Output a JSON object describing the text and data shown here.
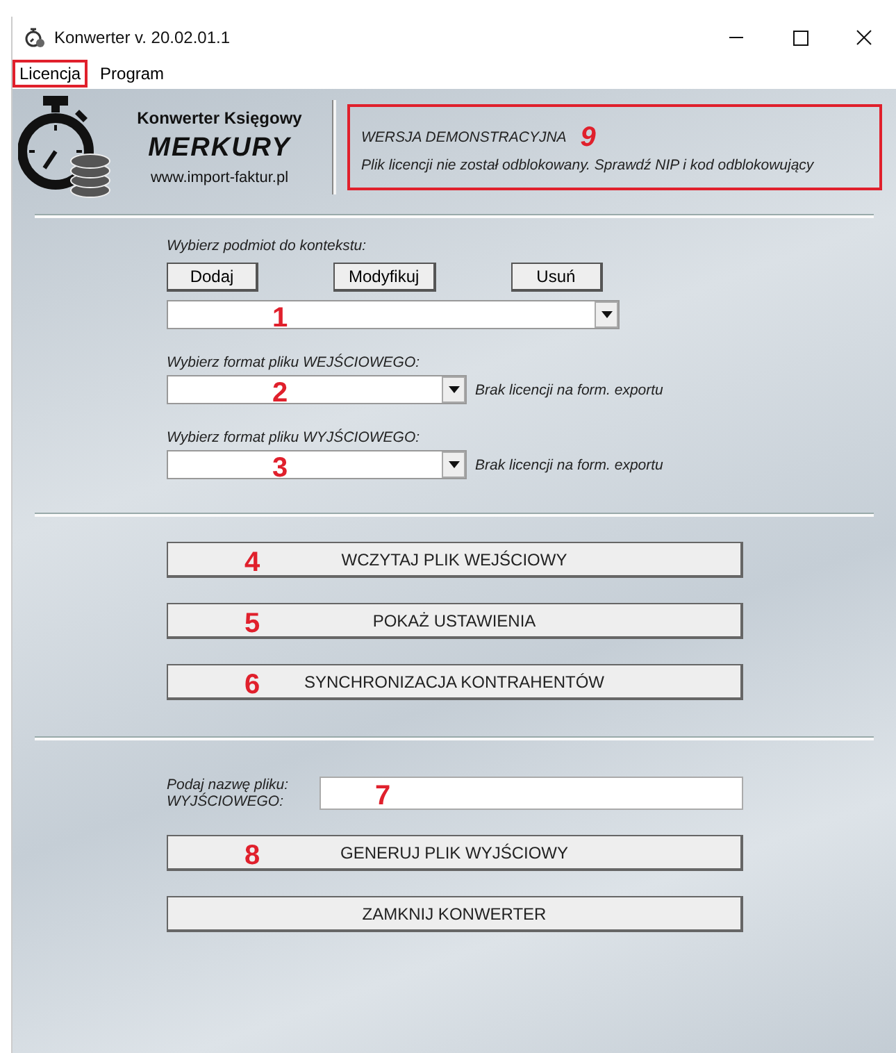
{
  "window": {
    "title": "Konwerter v. 20.02.01.1"
  },
  "menu": [
    {
      "label": "Licencja",
      "annotated": true
    },
    {
      "label": "Program",
      "annotated": false
    }
  ],
  "header": {
    "logo_title": "Konwerter Księgowy",
    "logo_name": "MERKURY",
    "logo_url": "www.import-faktur.pl",
    "notice_title": "WERSJA DEMONSTRACYJNA",
    "notice_marker": "9",
    "notice_message": "Plik licencji nie został odblokowany. Sprawdź NIP i kod odblokowujący"
  },
  "entity": {
    "label": "Wybierz podmiot do kontekstu:",
    "buttons": [
      "Dodaj",
      "Modyfikuj",
      "Usuń"
    ],
    "marker": "1"
  },
  "formats": [
    {
      "label": "Wybierz format pliku WEJŚCIOWEGO:",
      "marker": "2",
      "note": "Brak licencji na form. exportu"
    },
    {
      "label": "Wybierz format pliku WYJŚCIOWEGO:",
      "marker": "3",
      "note": "Brak licencji na form. exportu"
    }
  ],
  "actions": [
    {
      "label": "WCZYTAJ PLIK WEJŚCIOWY",
      "marker": "4"
    },
    {
      "label": "POKAŻ USTAWIENIA",
      "marker": "5"
    },
    {
      "label": "SYNCHRONIZACJA KONTRAHENTÓW",
      "marker": "6"
    }
  ],
  "file_name": {
    "label_lines": [
      "Podaj nazwę pliku:",
      "WYJŚCIOWEGO:"
    ],
    "marker": "7"
  },
  "final_actions": [
    {
      "label": "GENERUJ PLIK WYJŚCIOWY",
      "marker": "8"
    },
    {
      "label": "ZAMKNIJ KONWERTER"
    }
  ]
}
